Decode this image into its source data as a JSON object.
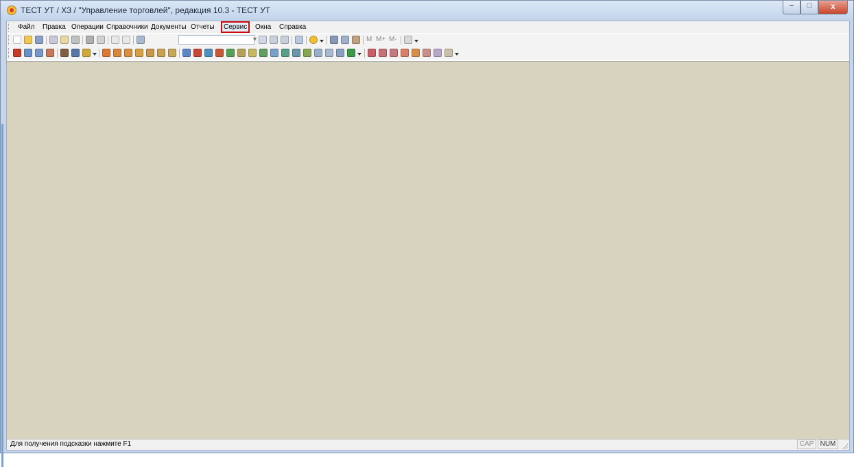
{
  "window": {
    "title": "ТЕСТ УТ / ХЗ / \"Управление торговлей\", редакция 10.3 - ТЕСТ УТ",
    "controls": {
      "minimize": "–",
      "maximize": "□",
      "close": "x"
    }
  },
  "menu": {
    "items": [
      "Файл",
      "Правка",
      "Операции",
      "Справочники",
      "Документы",
      "Отчеты",
      "Сервис",
      "Окна",
      "Справка"
    ],
    "highlighted": "Сервис"
  },
  "toolbar1": {
    "search_value": "",
    "memory_buttons": [
      "M",
      "M+",
      "M-"
    ]
  },
  "colors": {
    "workspace": "#d8d3bf",
    "highlight_border": "#cc0a0a",
    "title_gradient_top": "#dbe7f5"
  },
  "statusbar": {
    "hint": "Для получения подсказки нажмите F1",
    "cap": "CAP",
    "num": "NUM"
  }
}
